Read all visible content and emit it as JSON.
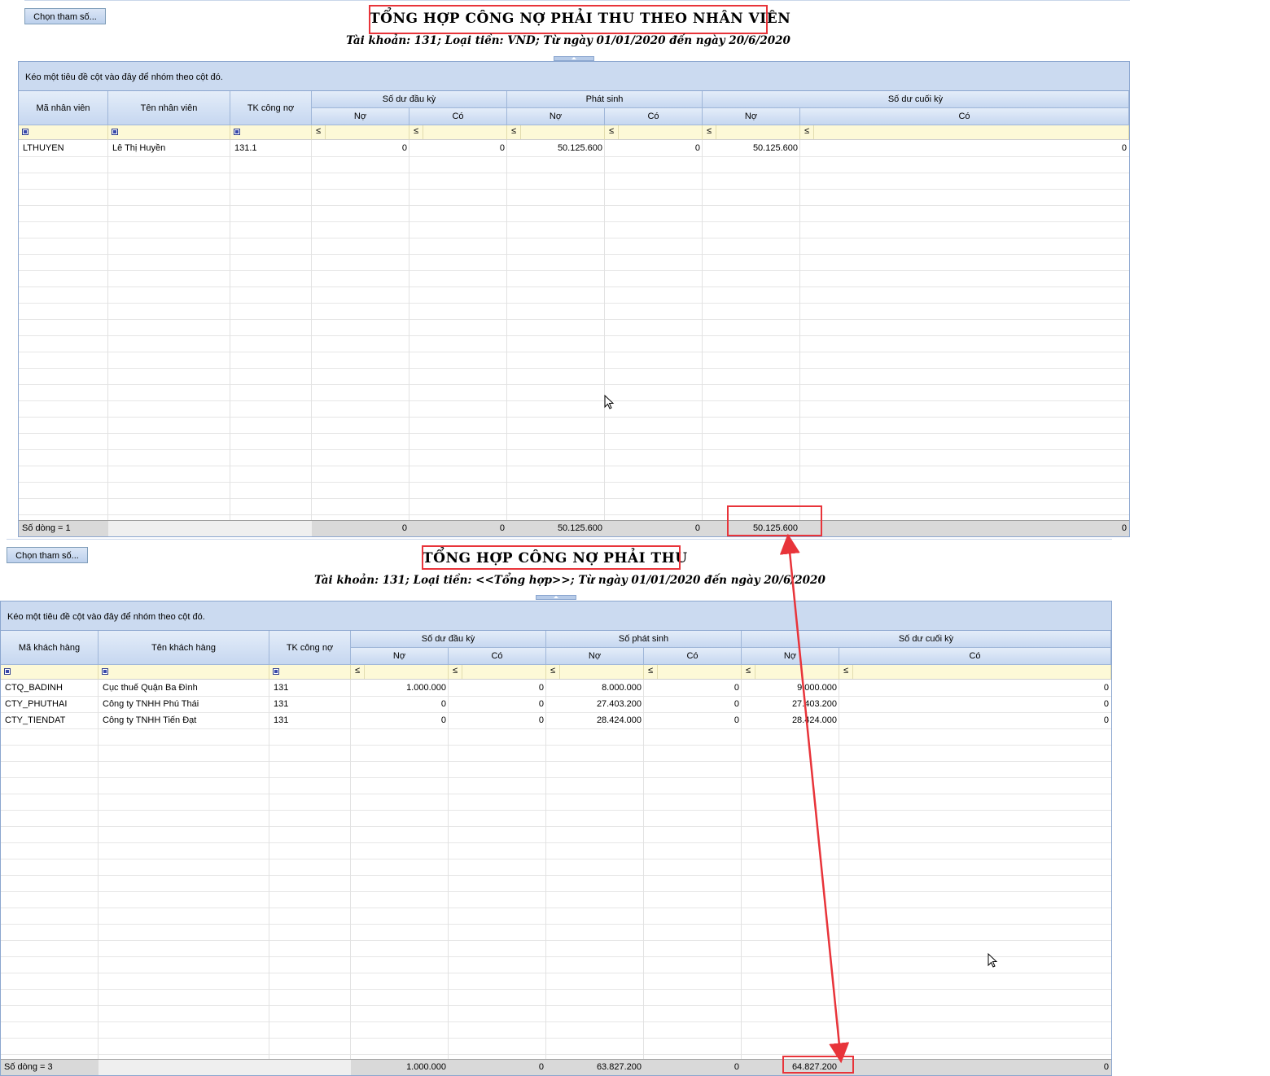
{
  "report1": {
    "button_label": "Chọn tham số...",
    "title": "TỔNG HỢP CÔNG NỢ PHẢI THU THEO NHÂN VIÊN",
    "subtitle": "Tài khoản: 131; Loại tiền: VND; Từ ngày 01/01/2020 đến ngày 20/6/2020",
    "group_panel_text": "Kéo một tiêu đề cột vào đây để nhóm theo cột đó.",
    "columns": {
      "code": "Mã nhân viên",
      "name": "Tên nhân viên",
      "account": "TK công nợ",
      "group_opening": "Số dư đầu kỳ",
      "group_arising": "Phát sinh",
      "group_closing": "Số dư cuối kỳ",
      "debit": "Nợ",
      "credit": "Có"
    },
    "filter_symbol": "≤",
    "rows": [
      {
        "code": "LTHUYEN",
        "name": "Lê Thị Huyền",
        "account": "131.1",
        "open_debit": "0",
        "open_credit": "0",
        "arise_debit": "50.125.600",
        "arise_credit": "0",
        "close_debit": "50.125.600",
        "close_credit": "0"
      }
    ],
    "footer": {
      "count_label": "Số dòng = 1",
      "open_debit": "0",
      "open_credit": "0",
      "arise_debit": "50.125.600",
      "arise_credit": "0",
      "close_debit": "50.125.600",
      "close_credit": "0"
    }
  },
  "report2": {
    "button_label": "Chọn tham số...",
    "title": "TỔNG HỢP CÔNG NỢ PHẢI THU",
    "subtitle": "Tài khoản: 131; Loại tiền: <<Tổng hợp>>; Từ ngày 01/01/2020 đến ngày 20/6/2020",
    "group_panel_text": "Kéo một tiêu đề cột vào đây để nhóm theo cột đó.",
    "columns": {
      "code": "Mã khách hàng",
      "name": "Tên khách hàng",
      "account": "TK công nợ",
      "group_opening": "Số dư đầu kỳ",
      "group_arising": "Số phát sinh",
      "group_closing": "Số dư cuối kỳ",
      "debit": "Nợ",
      "credit": "Có"
    },
    "filter_symbol": "≤",
    "rows": [
      {
        "code": "CTQ_BADINH",
        "name": "Cục thuế Quận Ba Đình",
        "account": "131",
        "open_debit": "1.000.000",
        "open_credit": "0",
        "arise_debit": "8.000.000",
        "arise_credit": "0",
        "close_debit": "9.000.000",
        "close_credit": "0"
      },
      {
        "code": "CTY_PHUTHAI",
        "name": "Công ty TNHH Phú Thái",
        "account": "131",
        "open_debit": "0",
        "open_credit": "0",
        "arise_debit": "27.403.200",
        "arise_credit": "0",
        "close_debit": "27.403.200",
        "close_credit": "0"
      },
      {
        "code": "CTY_TIENDAT",
        "name": "Công ty TNHH Tiến Đạt",
        "account": "131",
        "open_debit": "0",
        "open_credit": "0",
        "arise_debit": "28.424.000",
        "arise_credit": "0",
        "close_debit": "28.424.000",
        "close_credit": "0"
      }
    ],
    "footer": {
      "count_label": "Số dòng = 3",
      "open_debit": "1.000.000",
      "open_credit": "0",
      "arise_debit": "63.827.200",
      "arise_credit": "0",
      "close_debit": "64.827.200",
      "close_credit": "0"
    }
  },
  "colors": {
    "highlight": "#e8343a",
    "header": "#c6d7f0",
    "filter_row": "#fdf9d7",
    "footer": "#d9d9d9"
  },
  "icons": [
    "mouse-pointer-icon",
    "filter-square-icon"
  ]
}
